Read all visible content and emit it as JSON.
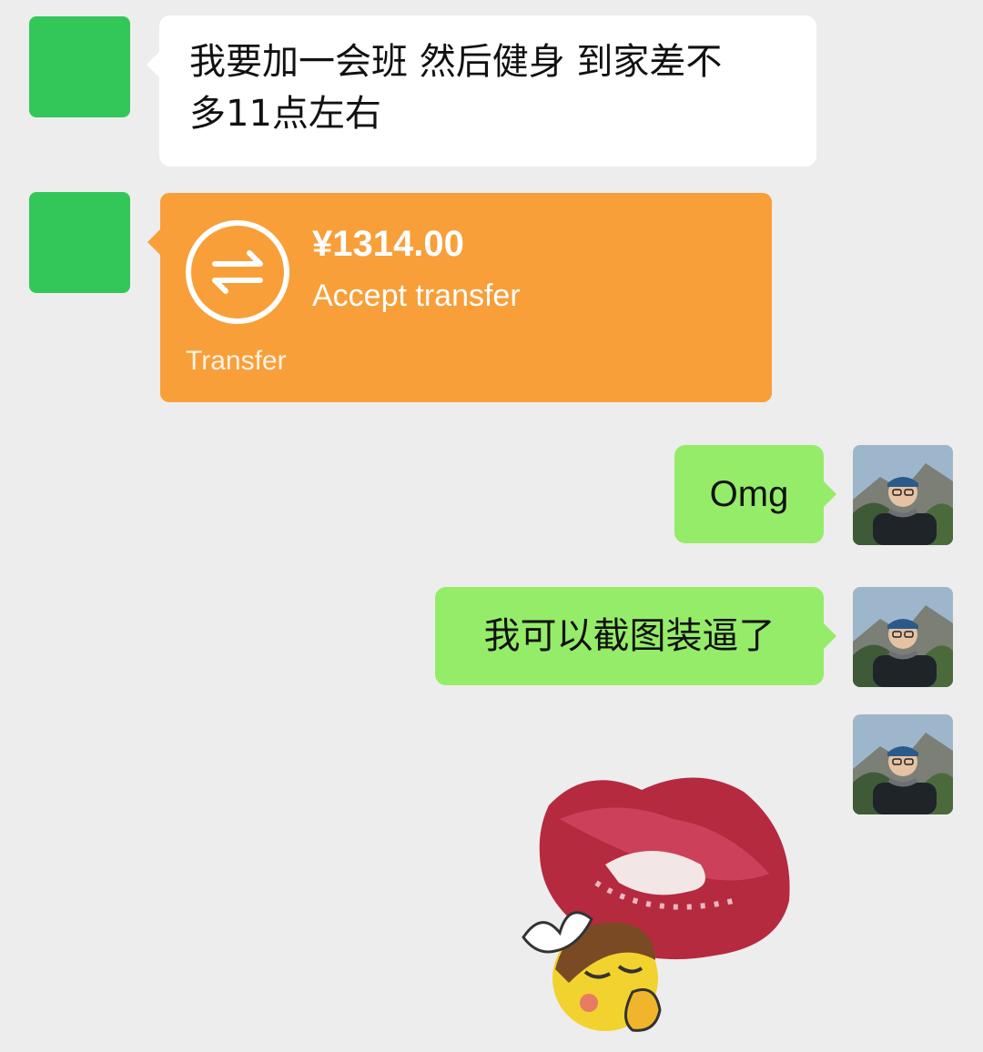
{
  "messages": {
    "m1": {
      "sender": "contact",
      "text_line1": "我要加一会班 然后健身 到家差不",
      "text_line2": "多11点左右"
    },
    "m2": {
      "sender": "contact",
      "type": "transfer",
      "amount": "¥1314.00",
      "status": "Accept transfer",
      "label": "Transfer",
      "icon": "transfer-arrows-icon"
    },
    "m3": {
      "sender": "me",
      "text": "Omg"
    },
    "m4": {
      "sender": "me",
      "text": "我可以截图装逼了"
    },
    "m5": {
      "sender": "me",
      "type": "sticker",
      "icon": "kiss-lips-sticker"
    }
  },
  "colors": {
    "background": "#ededed",
    "contact_avatar": "#33c759",
    "incoming_bubble": "#ffffff",
    "outgoing_bubble": "#95ec69",
    "transfer_card": "#f89f3a"
  }
}
